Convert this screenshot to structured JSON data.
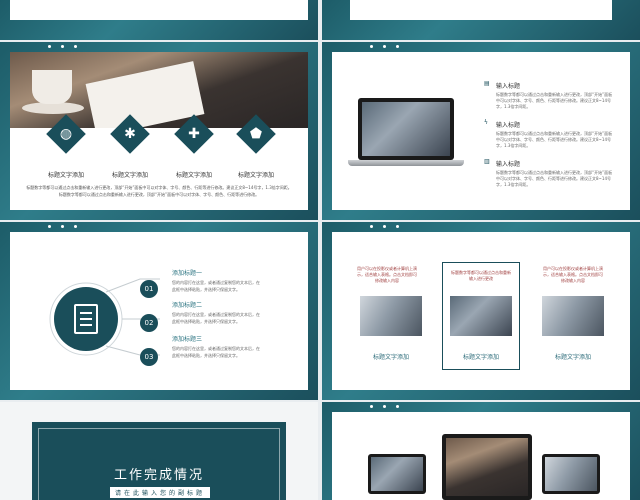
{
  "slide3": {
    "labels": [
      "标题文字添加",
      "标题文字添加",
      "标题文字添加",
      "标题文字添加"
    ],
    "icons": [
      "globe-icon",
      "aperture-icon",
      "plus-icon",
      "shield-icon"
    ],
    "paragraph_line1": "标题数字等都可以通过点击和重新输入进行更改，顶部“开始”面板中可以对字体、字号、颜色、行距等进行修改。建议正文8~14号字，1.3倍字间距。",
    "paragraph_line2": "标题数字等都可以通过点击和重新输入进行更改，顶部“开始”面板中可以对字体、字号、颜色、行距等进行修改。"
  },
  "slide4": {
    "items": [
      {
        "icon": "chat-icon",
        "title": "输入标题",
        "text": "标题数字等都可以通过点击和重新输入进行更改，顶部“开始”面板中可以对字体、字号、颜色、行距等进行修改。建议正文8~14号字，1.3倍字间距。"
      },
      {
        "icon": "bolt-icon",
        "title": "输入标题",
        "text": "标题数字等都可以通过点击和重新输入进行更改，顶部“开始”面板中可以对字体、字号、颜色、行距等进行修改。建议正文8~14号字，1.3倍字间距。"
      },
      {
        "icon": "doc-icon",
        "title": "输入标题",
        "text": "标题数字等都可以通过点击和重新输入进行更改，顶部“开始”面板中可以对字体、字号、颜色、行距等进行修改。建议正文8~14号字，1.3倍字间距。"
      }
    ]
  },
  "slide5": {
    "items": [
      {
        "num": "01",
        "title": "添加标题一",
        "text1": "您的内容打在这里，或者通过复制您的文本后，在",
        "text2": "此框中选择粘贴，并选择只保留文字。"
      },
      {
        "num": "02",
        "title": "添加标题二",
        "text1": "您的内容打在这里，或者通过复制您的文本后，在",
        "text2": "此框中选择粘贴，并选择只保留文字。"
      },
      {
        "num": "03",
        "title": "添加标题三",
        "text1": "您的内容打在这里，或者通过复制您的文本后，在",
        "text2": "此框中选择粘贴，并选择只保留文字。"
      }
    ]
  },
  "slide6": {
    "cards": [
      {
        "text": "用户可以在投影仪或者计算机上演示，适合输入表格。点击文档即可修改输入内容",
        "caption": "标题文字添加"
      },
      {
        "text": "标题数字等都可以通过点击和重新输入进行更改",
        "caption": "标题文字添加"
      },
      {
        "text": "用户可以在投影仪或者计算机上演示，适合输入表格。点击文档即可修改输入内容",
        "caption": "标题文字添加"
      }
    ]
  },
  "slide7": {
    "title": "工作完成情况",
    "subtitle": "请在此输入您的副标题"
  }
}
